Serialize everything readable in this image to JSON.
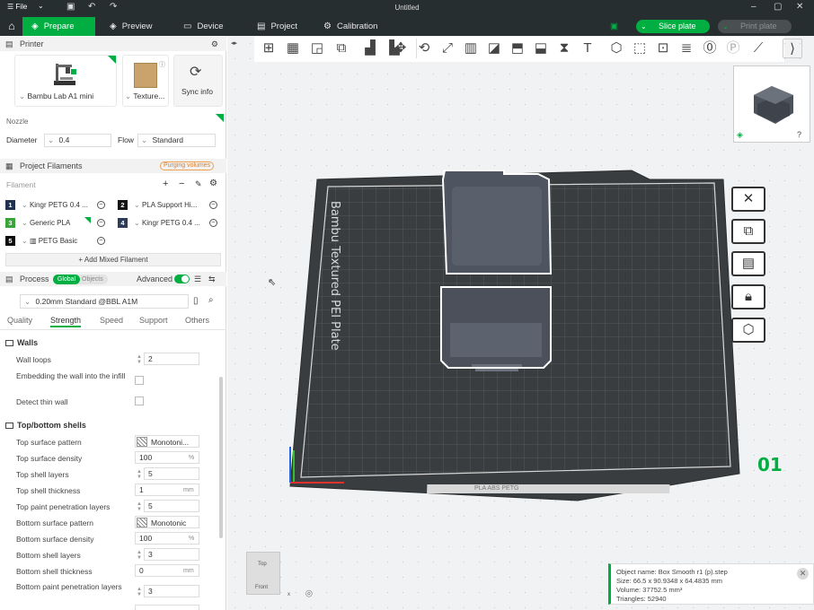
{
  "titlebar": {
    "file_menu": "File",
    "title": "Untitled"
  },
  "nav": {
    "tabs": [
      {
        "label": "Prepare",
        "icon": "cube-icon"
      },
      {
        "label": "Preview",
        "icon": "layers-icon"
      },
      {
        "label": "Device",
        "icon": "monitor-icon"
      },
      {
        "label": "Project",
        "icon": "document-icon"
      },
      {
        "label": "Calibration",
        "icon": "gear-icon"
      }
    ],
    "slice_button": "Slice plate",
    "print_button": "Print plate"
  },
  "printer": {
    "section_title": "Printer",
    "printer_name": "Bambu Lab A1 mini",
    "plate_type": "Texture...",
    "sync_label": "Sync info",
    "nozzle_label": "Nozzle",
    "diameter_label": "Diameter",
    "diameter_value": "0.4",
    "flow_label": "Flow",
    "flow_value": "Standard"
  },
  "filaments": {
    "section_title": "Project Filaments",
    "purging_badge": "Purging volumes",
    "filament_label": "Filament",
    "items": [
      {
        "num": "1",
        "name": "Kingr PETG 0.4 ...",
        "color": "#1f3050"
      },
      {
        "num": "2",
        "name": "PLA Support Hi...",
        "color": "#111111"
      },
      {
        "num": "3",
        "name": "Generic PLA",
        "color": "#3aa33a"
      },
      {
        "num": "4",
        "name": "Kingr PETG 0.4 ...",
        "color": "#2e3c58"
      },
      {
        "num": "5",
        "name": "PETG Basic",
        "color": "#0a0a0a"
      }
    ],
    "add_mixed": "+ Add Mixed Filament"
  },
  "process": {
    "section_title": "Process",
    "toggle_global": "Global",
    "toggle_objects": "Objects",
    "advanced_label": "Advanced",
    "preset": "0.20mm Standard @BBL A1M",
    "tabs": [
      "Quality",
      "Strength",
      "Speed",
      "Support",
      "Others"
    ],
    "active_tab": "Strength",
    "walls": {
      "title": "Walls",
      "wall_loops_label": "Wall loops",
      "wall_loops_value": "2",
      "embedding_label": "Embedding the wall into the infill",
      "detect_thin_label": "Detect thin wall"
    },
    "shells": {
      "title": "Top/bottom shells",
      "top_pattern_label": "Top surface pattern",
      "top_pattern_value": "Monotoni...",
      "top_density_label": "Top surface density",
      "top_density_value": "100",
      "top_layers_label": "Top shell layers",
      "top_layers_value": "5",
      "top_thickness_label": "Top shell thickness",
      "top_thickness_value": "1",
      "top_paint_label": "Top paint penetration layers",
      "top_paint_value": "5",
      "bottom_pattern_label": "Bottom surface pattern",
      "bottom_pattern_value": "Monotonic",
      "bottom_density_label": "Bottom surface density",
      "bottom_density_value": "100",
      "bottom_layers_label": "Bottom shell layers",
      "bottom_layers_value": "3",
      "bottom_thickness_label": "Bottom shell thickness",
      "bottom_thickness_value": "0",
      "bottom_paint_label": "Bottom paint penetration layers",
      "bottom_paint_value": "3",
      "unit_pct": "%",
      "unit_mm": "mm"
    }
  },
  "viewport": {
    "plate_label": "Bambu Textured PEI Plate",
    "plate_number": "01",
    "bed_tag": "PLA ABS PETG",
    "navcube_top": "Top",
    "navcube_front": "Front",
    "axis_x": "x",
    "object_info": {
      "name": "Object name: Box Smooth r1 (p).step",
      "size": "Size: 66.5 x 90.9348 x 64.4835 mm",
      "volume": "Volume: 37752.5 mm³",
      "triangles": "Triangles: 52940"
    }
  },
  "colors": {
    "accent": "#00ae42",
    "dark_bar": "#262e30",
    "bed": "#3a3d3f",
    "object": "#555a63"
  }
}
